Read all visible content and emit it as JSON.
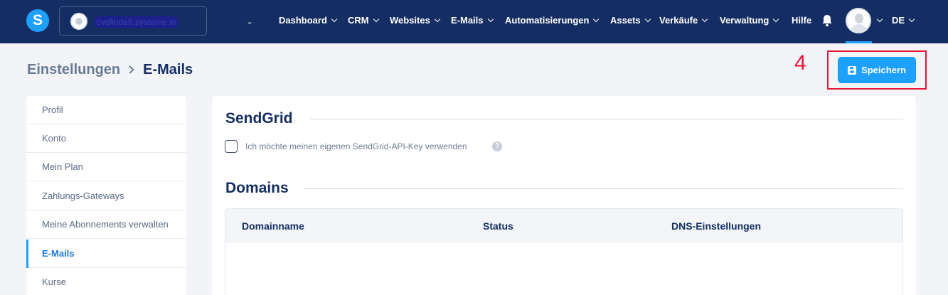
{
  "app": {
    "logo_letter": "S"
  },
  "workspace": {
    "name": "cvdlinde6.systeme.io"
  },
  "nav": {
    "items": [
      {
        "label": "Dashboard",
        "has_dropdown": true
      },
      {
        "label": "CRM",
        "has_dropdown": true
      },
      {
        "label": "Websites",
        "has_dropdown": true
      },
      {
        "label": "E-Mails",
        "has_dropdown": true
      },
      {
        "label": "Automatisierungen",
        "has_dropdown": true
      },
      {
        "label": "Assets",
        "has_dropdown": true
      },
      {
        "label": "Verkäufe",
        "has_dropdown": true
      },
      {
        "label": "Verwaltung",
        "has_dropdown": true
      },
      {
        "label": "Hilfe",
        "has_dropdown": false
      }
    ],
    "language": "DE"
  },
  "breadcrumb": {
    "parent": "Einstellungen",
    "current": "E-Mails"
  },
  "annotation": {
    "step_number": "4"
  },
  "toolbar": {
    "save_label": "Speichern"
  },
  "sidebar": {
    "items": [
      {
        "label": "Profil"
      },
      {
        "label": "Konto"
      },
      {
        "label": "Mein Plan"
      },
      {
        "label": "Zahlungs-Gateways"
      },
      {
        "label": "Meine Abonnements verwalten"
      },
      {
        "label": "E-Mails",
        "active": true
      },
      {
        "label": "Kurse"
      }
    ]
  },
  "sendgrid": {
    "title": "SendGrid",
    "checkbox_label": "Ich möchte meinen eigenen SendGrid-API-Key verwenden",
    "checked": false
  },
  "domains": {
    "title": "Domains",
    "columns": [
      "Domainname",
      "Status",
      "DNS-Einstellungen"
    ]
  },
  "colors": {
    "topbar": "#142d63",
    "accent": "#1ea0ff",
    "annotation": "#e8153a"
  }
}
